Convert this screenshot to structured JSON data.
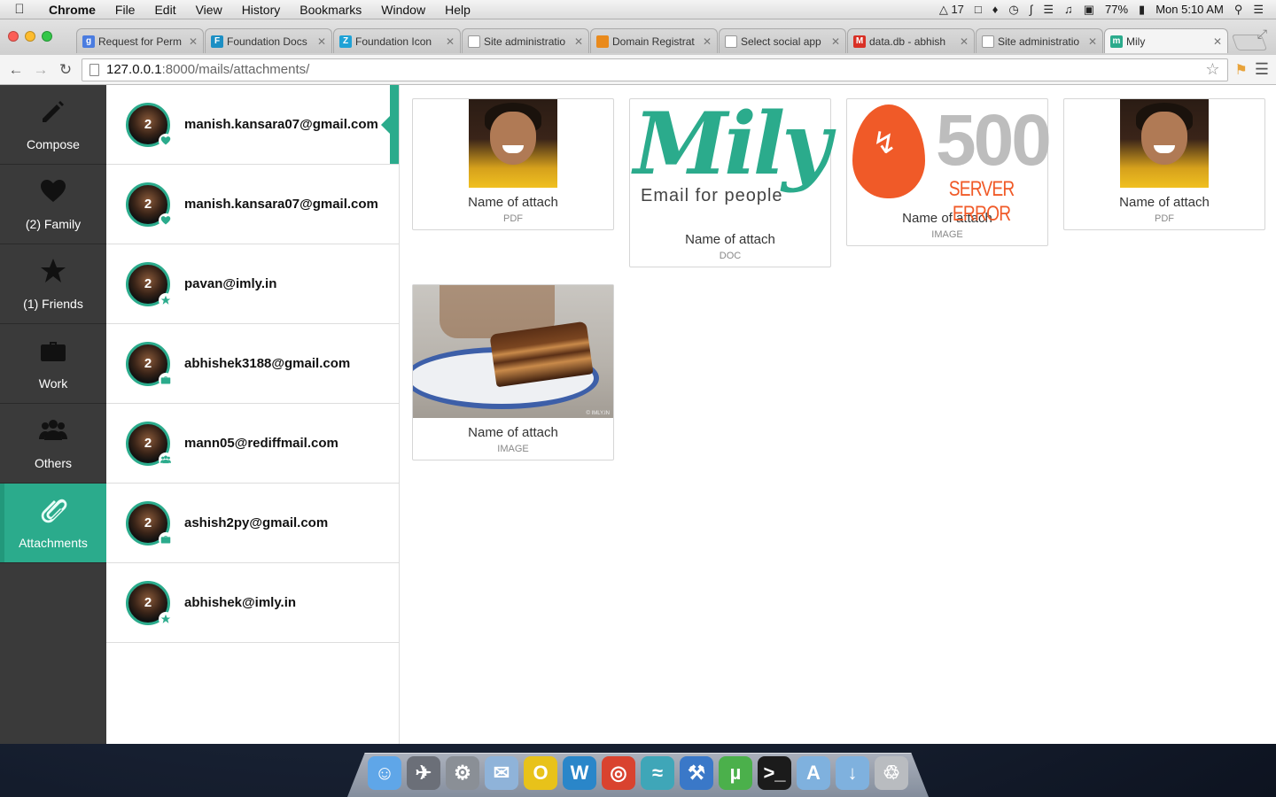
{
  "menubar": {
    "app_name": "Chrome",
    "menus": [
      "File",
      "Edit",
      "View",
      "History",
      "Bookmarks",
      "Window",
      "Help"
    ],
    "status_adobe": "17",
    "battery": "77%",
    "clock": "Mon 5:10 AM"
  },
  "tabs": [
    {
      "title": "Request for Perm",
      "fav_color": "#4a7ce0",
      "fav_char": "g",
      "active": false
    },
    {
      "title": "Foundation Docs",
      "fav_color": "#1c8fc4",
      "fav_char": "F",
      "active": false
    },
    {
      "title": "Foundation Icon",
      "fav_color": "#1fa2d6",
      "fav_char": "Z",
      "active": false
    },
    {
      "title": "Site administratio",
      "fav_color": "#ffffff",
      "fav_char": "",
      "active": false
    },
    {
      "title": "Domain Registrat",
      "fav_color": "#e98a1c",
      "fav_char": "",
      "active": false
    },
    {
      "title": "Select social app",
      "fav_color": "#ffffff",
      "fav_char": "",
      "active": false
    },
    {
      "title": "data.db - abhish",
      "fav_color": "#d93025",
      "fav_char": "M",
      "active": false
    },
    {
      "title": "Site administratio",
      "fav_color": "#ffffff",
      "fav_char": "",
      "active": false
    },
    {
      "title": "Mily",
      "fav_color": "#2bab8c",
      "fav_char": "m",
      "active": true
    }
  ],
  "address_bar": {
    "host": "127.0.0.1",
    "path": ":8000/mails/attachments/"
  },
  "left_nav": [
    {
      "label": "Compose",
      "icon": "pencil-icon",
      "active": false
    },
    {
      "label": "(2) Family",
      "icon": "heart-icon",
      "active": false
    },
    {
      "label": "(1) Friends",
      "icon": "star-icon",
      "active": false
    },
    {
      "label": "Work",
      "icon": "briefcase-icon",
      "active": false
    },
    {
      "label": "Others",
      "icon": "people-icon",
      "active": false
    },
    {
      "label": "Attachments",
      "icon": "paperclip-icon",
      "active": true
    }
  ],
  "mails": [
    {
      "email": "manish.kansara07@gmail.com",
      "count": "2",
      "badge": "heart-icon",
      "active": true
    },
    {
      "email": "manish.kansara07@gmail.com",
      "count": "2",
      "badge": "heart-icon",
      "active": false
    },
    {
      "email": "pavan@imly.in",
      "count": "2",
      "badge": "star-icon",
      "active": false
    },
    {
      "email": "abhishek3188@gmail.com",
      "count": "2",
      "badge": "briefcase-icon",
      "active": false
    },
    {
      "email": "mann05@rediffmail.com",
      "count": "2",
      "badge": "people-icon",
      "active": false
    },
    {
      "email": "ashish2py@gmail.com",
      "count": "2",
      "badge": "briefcase-icon",
      "active": false
    },
    {
      "email": "abhishek@imly.in",
      "count": "2",
      "badge": "star-icon",
      "active": false
    }
  ],
  "attachments": [
    {
      "name": "Name of attach",
      "type": "PDF",
      "thumb": "photo"
    },
    {
      "name": "Name of attach",
      "type": "DOC",
      "thumb": "mily-logo",
      "logo_text": "Mily",
      "tagline": "Email for people"
    },
    {
      "name": "Name of attach",
      "type": "IMAGE",
      "thumb": "server-error",
      "code": "500",
      "message": "SERVER ERROR"
    },
    {
      "name": "Name of attach",
      "type": "PDF",
      "thumb": "photo"
    },
    {
      "name": "Name of attach",
      "type": "IMAGE",
      "thumb": "food-photo",
      "watermark": "© IMLY.IN"
    }
  ],
  "dock": {
    "apps": [
      "finder-icon",
      "launchpad-icon",
      "system-preferences-icon",
      "mail-icon",
      "opera-icon",
      "wordpress-icon",
      "chrome-icon",
      "instruments-icon",
      "xcode-icon",
      "utorrent-icon",
      "terminal-icon",
      "applications-folder-icon",
      "downloads-folder-icon",
      "trash-icon"
    ]
  },
  "colors": {
    "accent": "#2bab8c",
    "sidebar_bg": "#3a3a3a",
    "error_orange": "#f05a28"
  }
}
